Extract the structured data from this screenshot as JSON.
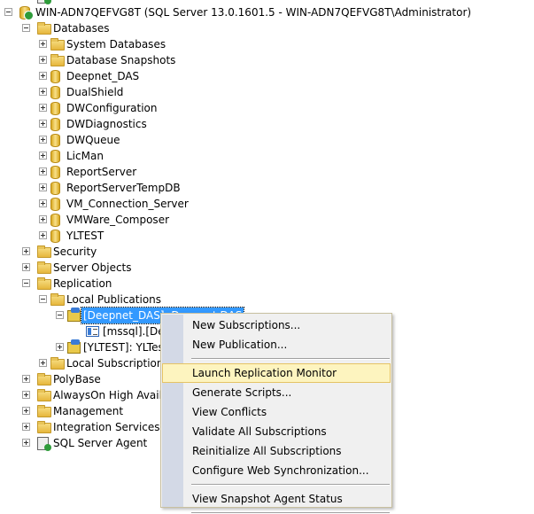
{
  "tree": [
    {
      "label": "",
      "icon": "agent",
      "expander": "none",
      "depth": 1
    },
    {
      "label": "WIN-ADN7QEFVG8T (SQL Server 13.0.1601.5 - WIN-ADN7QEFVG8T\\Administrator)",
      "icon": "server",
      "expander": "minus",
      "depth": 0
    },
    {
      "label": "Databases",
      "icon": "folder",
      "expander": "minus",
      "depth": 1
    },
    {
      "label": "System Databases",
      "icon": "folder",
      "expander": "plus",
      "depth": 2
    },
    {
      "label": "Database Snapshots",
      "icon": "folder",
      "expander": "plus",
      "depth": 2
    },
    {
      "label": "Deepnet_DAS",
      "icon": "db",
      "expander": "plus",
      "depth": 2
    },
    {
      "label": "DualShield",
      "icon": "db",
      "expander": "plus",
      "depth": 2
    },
    {
      "label": "DWConfiguration",
      "icon": "db",
      "expander": "plus",
      "depth": 2
    },
    {
      "label": "DWDiagnostics",
      "icon": "db",
      "expander": "plus",
      "depth": 2
    },
    {
      "label": "DWQueue",
      "icon": "db",
      "expander": "plus",
      "depth": 2
    },
    {
      "label": "LicMan",
      "icon": "db",
      "expander": "plus",
      "depth": 2
    },
    {
      "label": "ReportServer",
      "icon": "db",
      "expander": "plus",
      "depth": 2
    },
    {
      "label": "ReportServerTempDB",
      "icon": "db",
      "expander": "plus",
      "depth": 2
    },
    {
      "label": "VM_Connection_Server",
      "icon": "db",
      "expander": "plus",
      "depth": 2
    },
    {
      "label": "VMWare_Composer",
      "icon": "db",
      "expander": "plus",
      "depth": 2
    },
    {
      "label": "YLTEST",
      "icon": "db",
      "expander": "plus",
      "depth": 2
    },
    {
      "label": "Security",
      "icon": "folder",
      "expander": "plus",
      "depth": 1
    },
    {
      "label": "Server Objects",
      "icon": "folder",
      "expander": "plus",
      "depth": 1
    },
    {
      "label": "Replication",
      "icon": "folder",
      "expander": "minus",
      "depth": 1
    },
    {
      "label": "Local Publications",
      "icon": "folder",
      "expander": "minus",
      "depth": 2
    },
    {
      "label": "[Deepnet_DAS]: Deepnet DAS",
      "icon": "pub",
      "expander": "minus",
      "depth": 3,
      "selected": true
    },
    {
      "label": "[mssql].[Dee",
      "icon": "sub",
      "expander": "none",
      "depth": 4
    },
    {
      "label": "[YLTEST]: YLTes",
      "icon": "pub",
      "expander": "plus",
      "depth": 3
    },
    {
      "label": "Local Subscriptions",
      "icon": "folder",
      "expander": "plus",
      "depth": 2
    },
    {
      "label": "PolyBase",
      "icon": "folder",
      "expander": "plus",
      "depth": 1
    },
    {
      "label": "AlwaysOn High Availa",
      "icon": "folder",
      "expander": "plus",
      "depth": 1
    },
    {
      "label": "Management",
      "icon": "folder",
      "expander": "plus",
      "depth": 1
    },
    {
      "label": "Integration Services Ca",
      "icon": "folder",
      "expander": "plus",
      "depth": 1
    },
    {
      "label": "SQL Server Agent",
      "icon": "agent",
      "expander": "plus",
      "depth": 1
    }
  ],
  "context_menu": {
    "items": [
      {
        "label": "New Subscriptions..."
      },
      {
        "label": "New Publication..."
      },
      {
        "separator": true
      },
      {
        "label": "Launch Replication Monitor",
        "highlighted": true
      },
      {
        "label": "Generate Scripts..."
      },
      {
        "label": "View Conflicts"
      },
      {
        "label": "Validate All Subscriptions"
      },
      {
        "label": "Reinitialize All Subscriptions"
      },
      {
        "label": "Configure Web Synchronization..."
      },
      {
        "separator": true
      },
      {
        "label": "View Snapshot Agent Status"
      },
      {
        "separator": true
      }
    ]
  },
  "colors": {
    "selection": "#3399ff",
    "menu_highlight": "#fdf4bf",
    "menu_gutter": "#d3d9e6"
  }
}
